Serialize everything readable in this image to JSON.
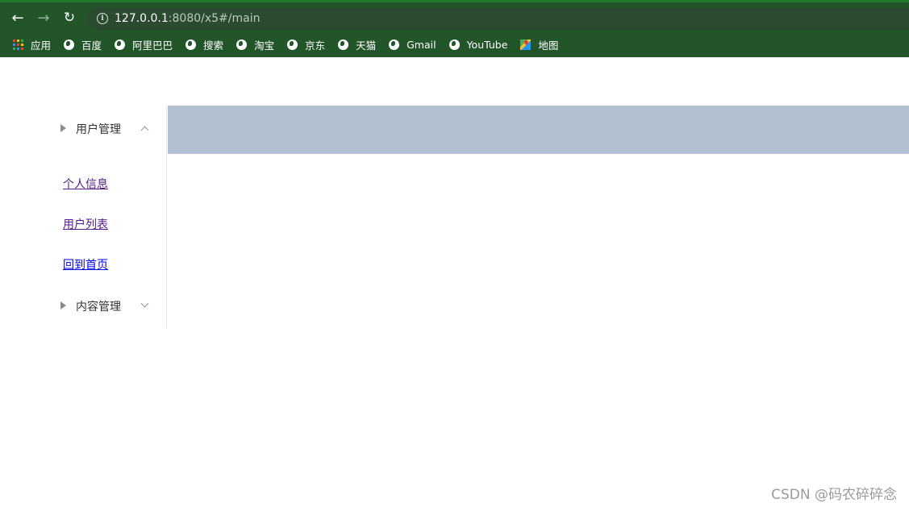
{
  "browser": {
    "url_host": "127.0.0.1",
    "url_rest": ":8080/x5#/main",
    "bookmarks": [
      {
        "label": "应用",
        "icon": "apps-grid-icon"
      },
      {
        "label": "百度",
        "icon": "globe-icon"
      },
      {
        "label": "阿里巴巴",
        "icon": "globe-icon"
      },
      {
        "label": "搜索",
        "icon": "globe-icon"
      },
      {
        "label": "淘宝",
        "icon": "globe-icon"
      },
      {
        "label": "京东",
        "icon": "globe-icon"
      },
      {
        "label": "天猫",
        "icon": "globe-icon"
      },
      {
        "label": "Gmail",
        "icon": "globe-icon"
      },
      {
        "label": "YouTube",
        "icon": "globe-icon"
      },
      {
        "label": "地图",
        "icon": "maps-icon"
      }
    ]
  },
  "sidebar": {
    "user_menu": {
      "title": "用户管理",
      "expanded": true
    },
    "links": [
      {
        "label": "个人信息"
      },
      {
        "label": "用户列表"
      },
      {
        "label": "回到首页"
      }
    ],
    "content_menu": {
      "title": "内容管理",
      "expanded": false
    }
  },
  "colors": {
    "browser_frame": "#23552b",
    "header_bar": "#b3c0d1",
    "visited_link": "#551a8b",
    "link": "#0000ee"
  },
  "watermark": "CSDN @码农碎碎念"
}
